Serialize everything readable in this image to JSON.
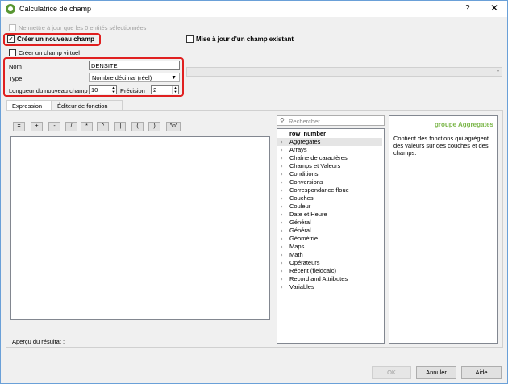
{
  "window": {
    "title": "Calculatrice de champ",
    "help_glyph": "?",
    "close_glyph": "✕"
  },
  "top": {
    "update_selected_label": "Ne mettre à jour que les 0 entités sélectionnées",
    "create_field_label": "Créer un nouveau champ",
    "update_existing_label": "Mise à jour d'un champ existant",
    "virtual_field_label": "Créer un champ virtuel"
  },
  "new_field": {
    "name_label": "Nom",
    "name_value": "DENSITE",
    "type_label": "Type",
    "type_value": "Nombre décimal (réel)",
    "length_label": "Longueur du nouveau champ",
    "length_value": "10",
    "precision_label": "Précision",
    "precision_value": "2"
  },
  "tabs": [
    {
      "label": "Expression",
      "active": true
    },
    {
      "label": "Éditeur de fonction",
      "active": false
    }
  ],
  "operators": [
    "=",
    "+",
    "-",
    "/",
    "*",
    "^",
    "||",
    "(",
    ")",
    "'\\n'"
  ],
  "search": {
    "placeholder": "Rechercher"
  },
  "function_tree": [
    {
      "label": "row_number",
      "bold": true,
      "expandable": false
    },
    {
      "label": "Aggregates",
      "expandable": true,
      "selected": true
    },
    {
      "label": "Arrays",
      "expandable": true
    },
    {
      "label": "Chaîne de caractères",
      "expandable": true
    },
    {
      "label": "Champs et Valeurs",
      "expandable": true
    },
    {
      "label": "Conditions",
      "expandable": true
    },
    {
      "label": "Conversions",
      "expandable": true
    },
    {
      "label": "Correspondance floue",
      "expandable": true
    },
    {
      "label": "Couches",
      "expandable": true
    },
    {
      "label": "Couleur",
      "expandable": true
    },
    {
      "label": "Date et Heure",
      "expandable": true
    },
    {
      "label": "Général",
      "expandable": true
    },
    {
      "label": "Général",
      "expandable": true
    },
    {
      "label": "Géométrie",
      "expandable": true
    },
    {
      "label": "Maps",
      "expandable": true
    },
    {
      "label": "Math",
      "expandable": true
    },
    {
      "label": "Opérateurs",
      "expandable": true
    },
    {
      "label": "Récent (fieldcalc)",
      "expandable": true
    },
    {
      "label": "Record and Attributes",
      "expandable": true
    },
    {
      "label": "Variables",
      "expandable": true
    }
  ],
  "help": {
    "title": "groupe Aggregates",
    "body": "Contient des fonctions qui agrègent des valeurs sur des couches et des champs.",
    "title_color": "#7ab648"
  },
  "preview_label": "Aperçu du résultat :",
  "buttons": {
    "ok": "OK",
    "cancel": "Annuler",
    "help": "Aide"
  },
  "highlight_color": "#e02020"
}
